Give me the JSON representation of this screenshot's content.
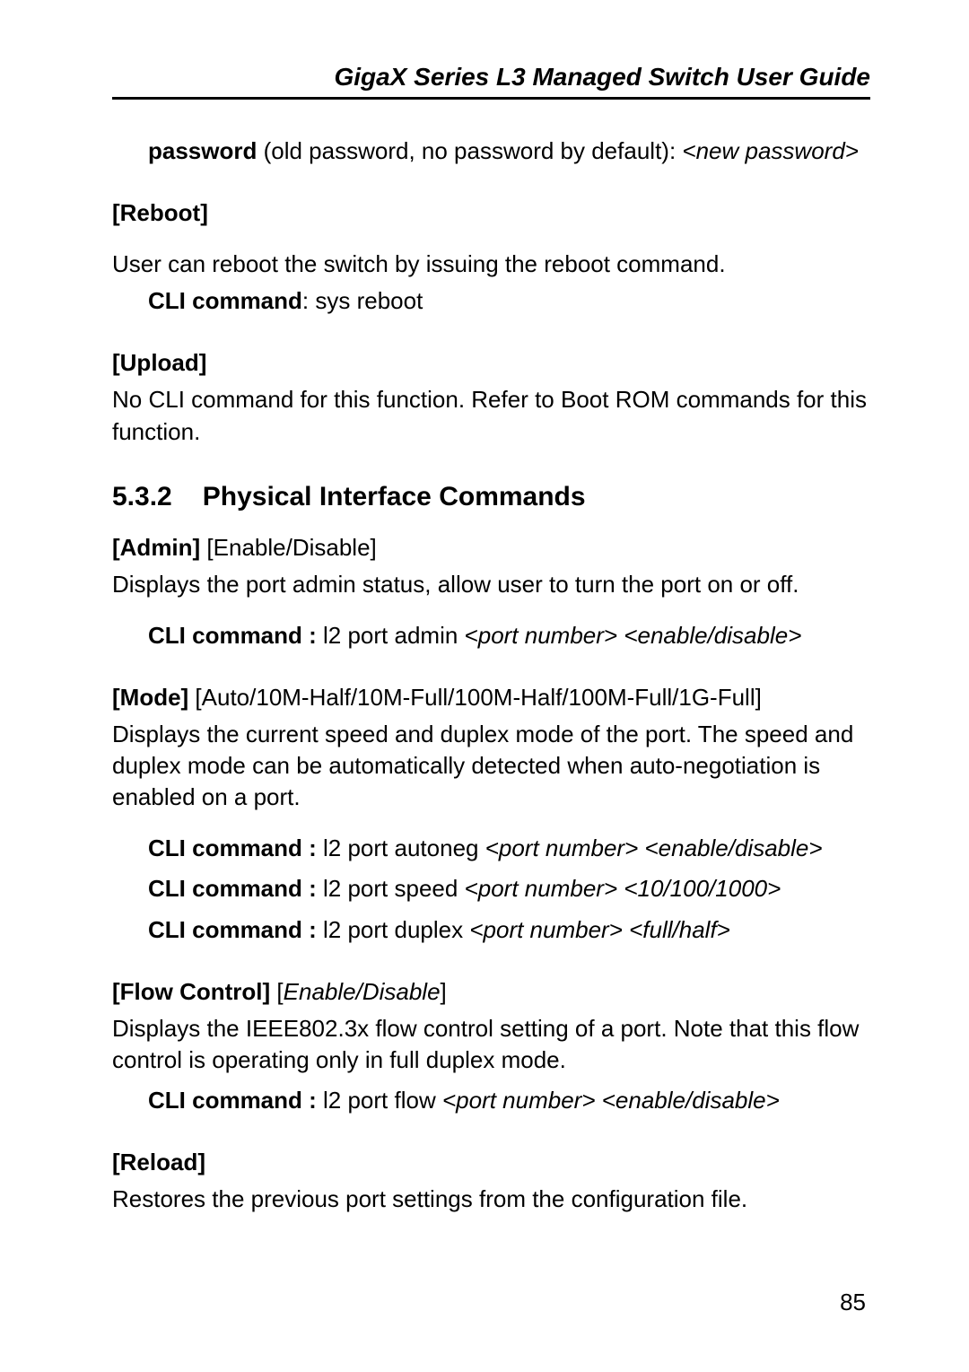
{
  "header": {
    "title": "GigaX Series L3 Managed Switch User Guide"
  },
  "password": {
    "label": "password",
    "desc": " (old password, no password by default): ",
    "arg": "<new password>"
  },
  "reboot": {
    "heading": "[Reboot]",
    "body": "User can reboot the switch by issuing the reboot command.",
    "cli_label": "CLI command",
    "cli_rest": ": sys reboot"
  },
  "upload": {
    "heading": "[Upload]",
    "body": "No CLI command for this function. Refer to Boot ROM commands for this function."
  },
  "section": {
    "number": "5.3.2",
    "title": "Physical Interface Commands"
  },
  "admin": {
    "heading": "[Admin] ",
    "heading_rest": "[Enable/Disable]",
    "body": "Displays the port admin status, allow user to turn the port on or off.",
    "cli_label": "CLI command : ",
    "cli_cmd": "l2 port admin ",
    "cli_arg": "<port number> <enable/disable>"
  },
  "mode": {
    "heading": "[Mode] ",
    "heading_rest": "[Auto/10M-Half/10M-Full/100M-Half/100M-Full/1G-Full]",
    "body": "Displays the current speed and duplex mode of the port. The speed and duplex mode can be automatically detected when auto-negotiation is enabled on a port.",
    "cli1_label": "CLI command : ",
    "cli1_cmd": "l2 port autoneg ",
    "cli1_arg": "<port number> <enable/disable>",
    "cli2_label": "CLI command : ",
    "cli2_cmd": "l2 port speed ",
    "cli2_arg": "<port number> <10/100/1000>",
    "cli3_label": "CLI command : ",
    "cli3_cmd": "l2 port duplex ",
    "cli3_arg": "<port number> <full/half>"
  },
  "flow": {
    "heading": "[Flow Control] ",
    "heading_rest_open": "[",
    "heading_rest_italic": "Enable/Disable",
    "heading_rest_close": "]",
    "body": "Displays the IEEE802.3x flow control setting of a port. Note that this flow control is operating only in full duplex mode.",
    "cli_label": "CLI command : ",
    "cli_cmd": "l2 port flow ",
    "cli_arg": "<port number> <enable/disable>"
  },
  "reload": {
    "heading": "[Reload]",
    "body": "Restores the previous port settings from the configuration file."
  },
  "page_number": "85"
}
